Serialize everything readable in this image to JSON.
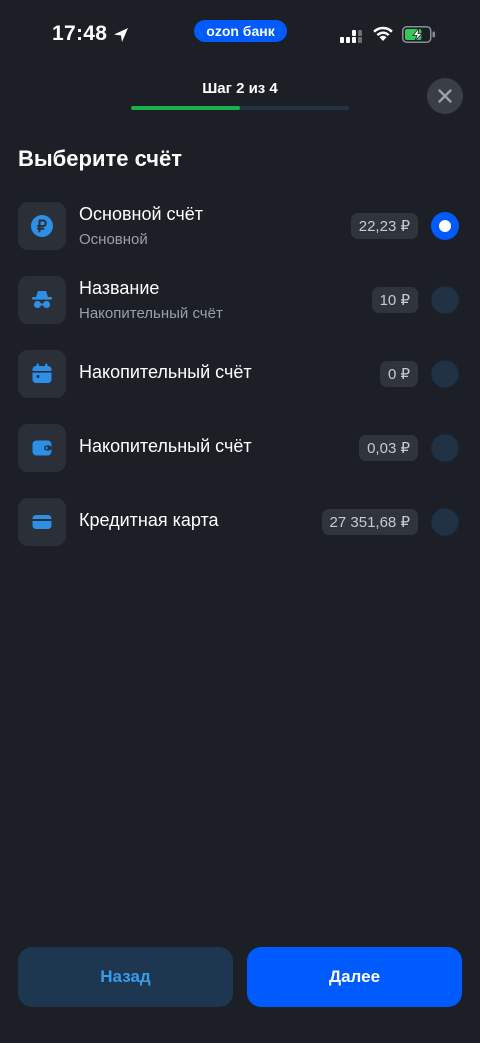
{
  "status_bar": {
    "time": "17:48",
    "brand": "ozon банк",
    "battery_level": 0.7
  },
  "header": {
    "step": "Шаг 2 из 4",
    "progress": 0.5
  },
  "title": "Выберите счёт",
  "accounts": [
    {
      "name": "Основной счёт",
      "subtitle": "Основной",
      "amount": "22,23 ₽",
      "icon": "ruble-icon",
      "selected": true
    },
    {
      "name": "Название",
      "subtitle": "Накопительный счёт",
      "amount": "10 ₽",
      "icon": "incognito-icon",
      "selected": false
    },
    {
      "name": "Накопительный счёт",
      "subtitle": "",
      "amount": "0 ₽",
      "icon": "calendar-icon",
      "selected": false
    },
    {
      "name": "Накопительный счёт",
      "subtitle": "",
      "amount": "0,03 ₽",
      "icon": "wallet-icon",
      "selected": false
    },
    {
      "name": "Кредитная карта",
      "subtitle": "",
      "amount": "27 351,68 ₽",
      "icon": "credit-card-icon",
      "selected": false
    }
  ],
  "buttons": {
    "back": "Назад",
    "next": "Далее"
  },
  "colors": {
    "accent": "#005bff",
    "icon_blue": "#2d8fe6",
    "progress_green": "#19b14a"
  }
}
